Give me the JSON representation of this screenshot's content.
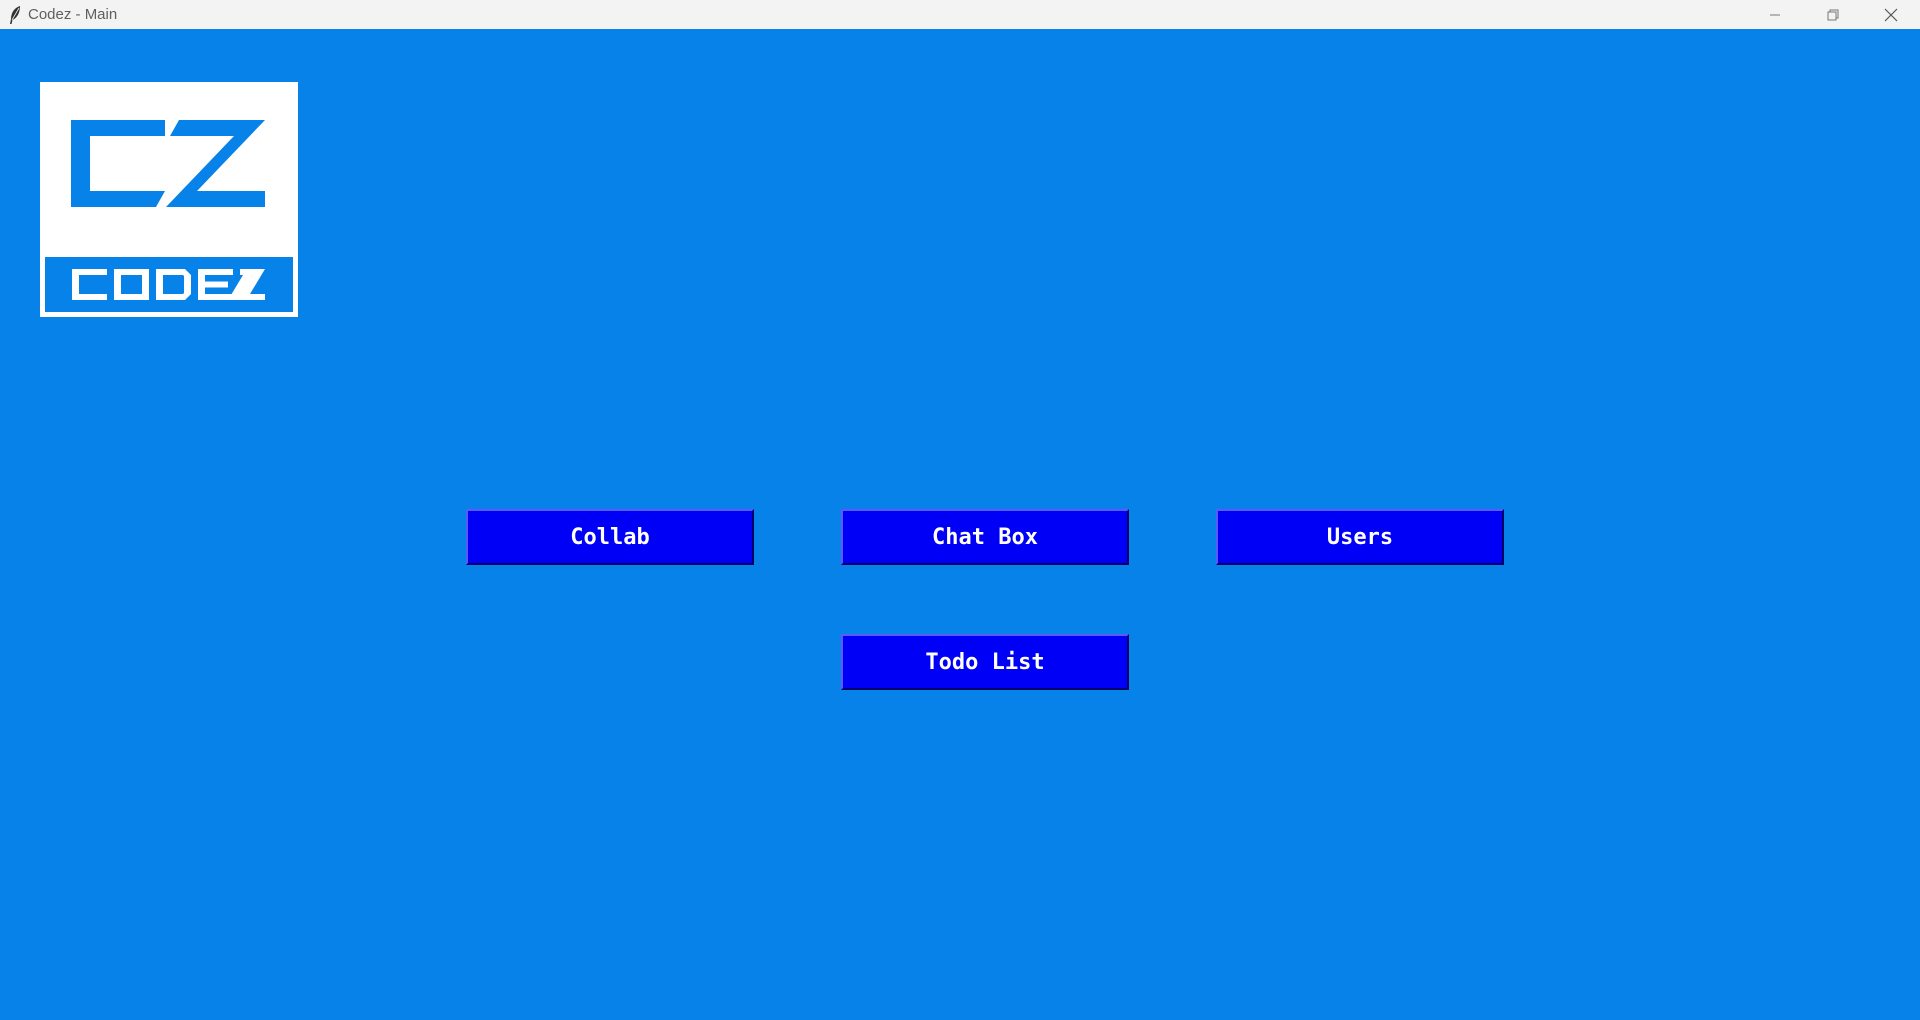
{
  "window": {
    "title": "Codez - Main",
    "app_icon": "feather-icon",
    "controls": [
      "minimize-icon",
      "restore-icon",
      "close-icon"
    ]
  },
  "logo": {
    "text": "CODEZ",
    "monogram": "CZ"
  },
  "buttons": {
    "collab": "Collab",
    "chat_box": "Chat Box",
    "users": "Users",
    "todo_list": "Todo List"
  },
  "colors": {
    "background": "#0682e8",
    "button": "#0000f7",
    "button_text": "#ffffff",
    "logo_bg": "#ffffff"
  }
}
